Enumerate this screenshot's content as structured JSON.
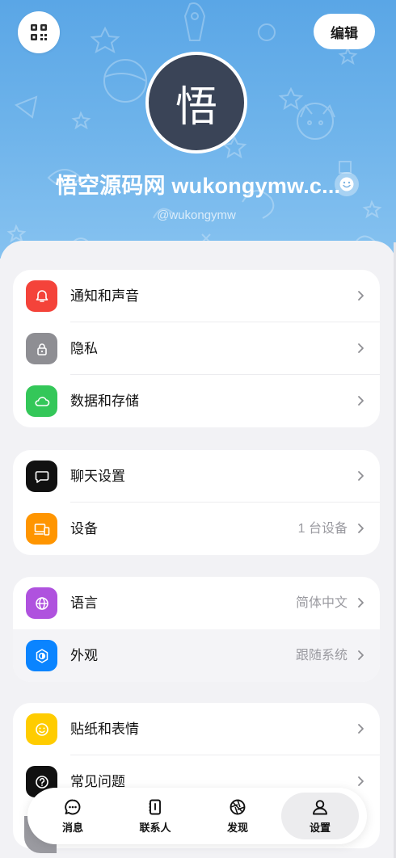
{
  "header": {
    "avatar_char": "悟",
    "name": "悟空源码网 wukongymw.c...",
    "username": "@wukongymw",
    "edit_label": "编辑"
  },
  "groups": [
    {
      "items": [
        {
          "label": "通知和声音",
          "value": "",
          "icon": "bell-icon",
          "color": "#f4433a"
        },
        {
          "label": "隐私",
          "value": "",
          "icon": "lock-icon",
          "color": "#8e8e93"
        },
        {
          "label": "数据和存储",
          "value": "",
          "icon": "cloud-icon",
          "color": "#34c759"
        }
      ]
    },
    {
      "items": [
        {
          "label": "聊天设置",
          "value": "",
          "icon": "chat-bubble-icon",
          "color": "#111111"
        },
        {
          "label": "设备",
          "value": "1 台设备",
          "icon": "devices-icon",
          "color": "#ff9500"
        }
      ]
    },
    {
      "items": [
        {
          "label": "语言",
          "value": "简体中文",
          "icon": "globe-icon",
          "color": "#af52de"
        },
        {
          "label": "外观",
          "value": "跟随系统",
          "icon": "appearance-icon",
          "color": "#0a84ff"
        }
      ]
    },
    {
      "items": [
        {
          "label": "贴纸和表情",
          "value": "",
          "icon": "smiley-icon",
          "color": "#ffcc00"
        },
        {
          "label": "常见问题",
          "value": "",
          "icon": "question-icon",
          "color": "#111111"
        }
      ]
    }
  ],
  "tabbar": {
    "tabs": [
      {
        "label": "消息",
        "icon": "message-icon",
        "active": false
      },
      {
        "label": "联系人",
        "icon": "contacts-icon",
        "active": false
      },
      {
        "label": "发现",
        "icon": "discover-icon",
        "active": false
      },
      {
        "label": "设置",
        "icon": "person-icon",
        "active": true
      }
    ]
  }
}
